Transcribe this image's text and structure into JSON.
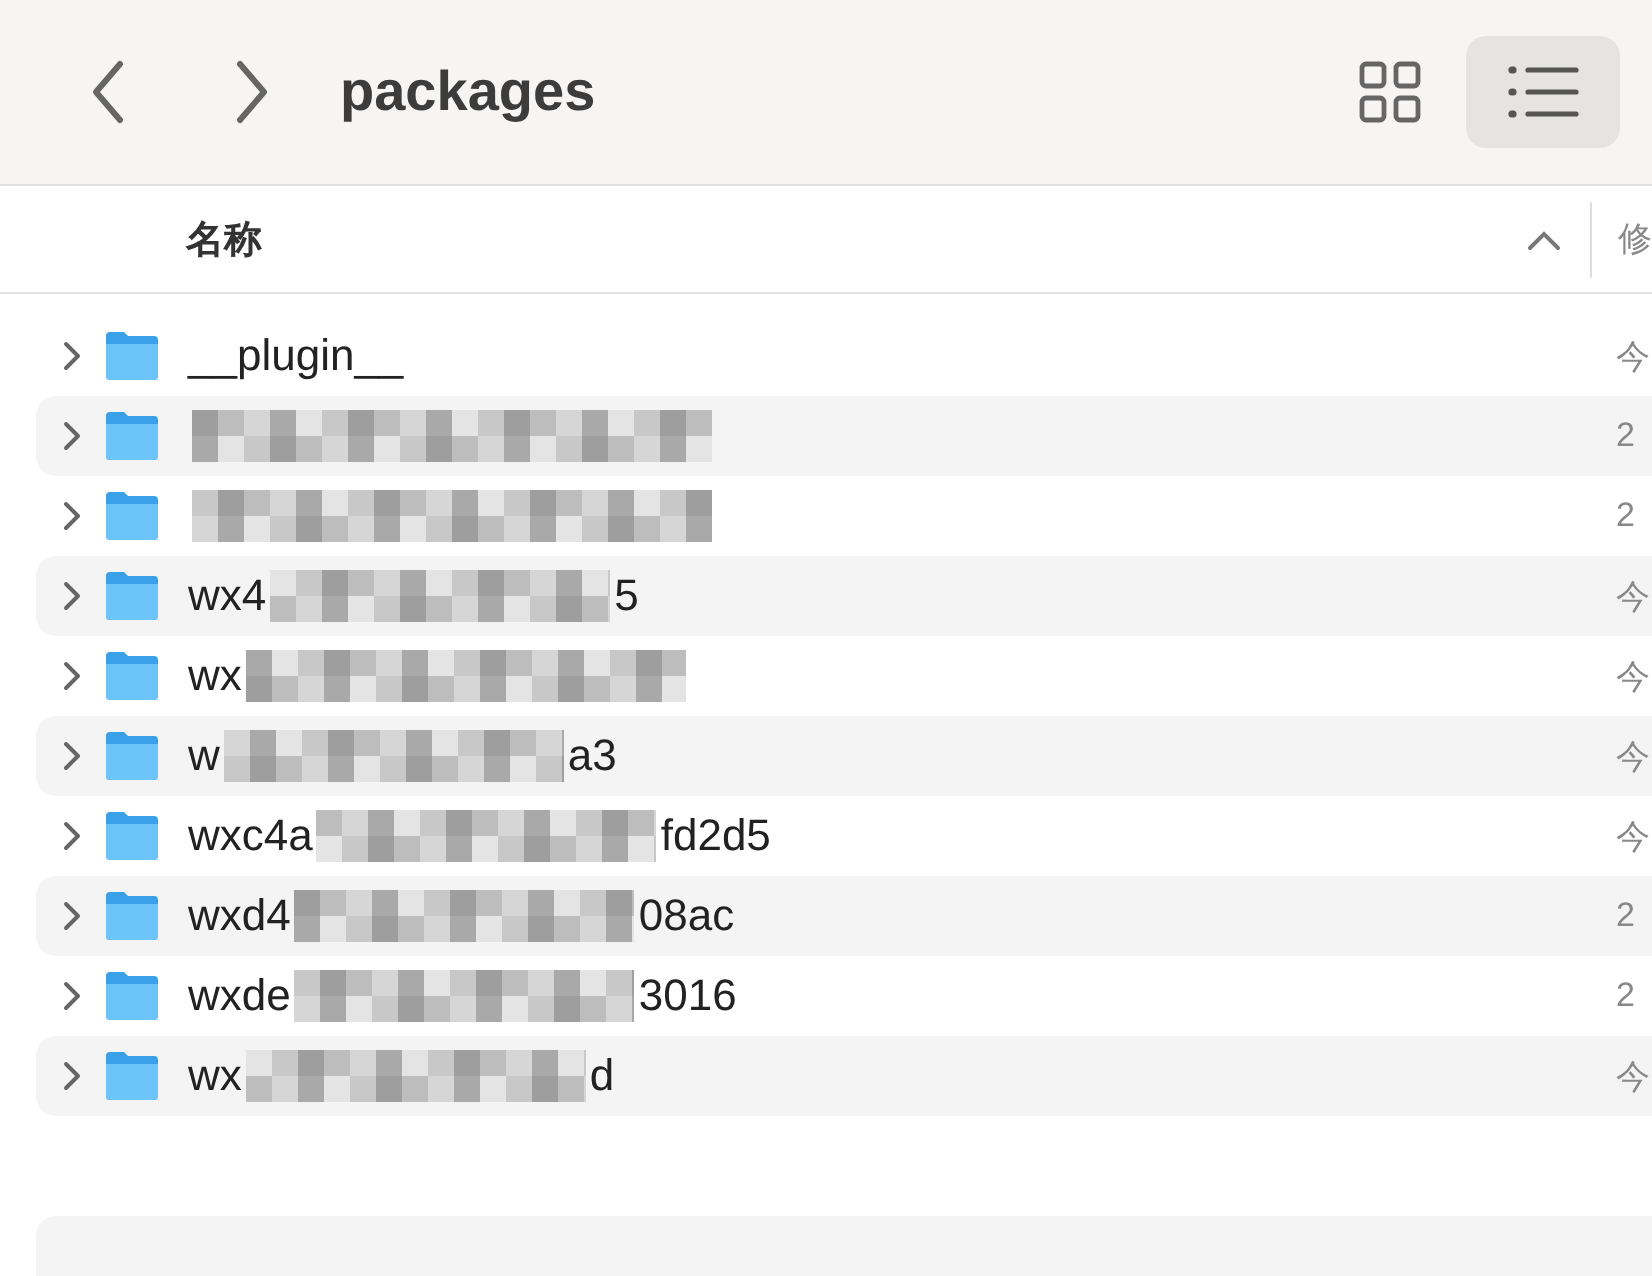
{
  "toolbar": {
    "title": "packages",
    "view_modes": [
      {
        "kind": "grid",
        "selected": false
      },
      {
        "kind": "list",
        "selected": true
      }
    ]
  },
  "columns": [
    {
      "label": "名称",
      "sorted": true
    },
    {
      "label": "修"
    }
  ],
  "rows": [
    {
      "name_start": "__plugin__",
      "redacted": false,
      "modified": "今"
    },
    {
      "redacted": true,
      "modified": "2"
    },
    {
      "redacted": true,
      "modified": "2"
    },
    {
      "name_start": "wx4",
      "name_end": "5",
      "redacted": true,
      "modified": "今"
    },
    {
      "name_start": "wx",
      "redacted": true,
      "modified": "今"
    },
    {
      "name_start": "w",
      "name_end": "a3",
      "redacted": true,
      "modified": "今"
    },
    {
      "name_start": "wxc4a",
      "name_end": "fd2d5",
      "redacted": true,
      "modified": "今"
    },
    {
      "name_start": "wxd4",
      "name_end": "08ac",
      "redacted": true,
      "modified": "2"
    },
    {
      "name_start": "wxde",
      "name_end": "3016",
      "redacted": true,
      "modified": "2"
    },
    {
      "name_start": "wx",
      "name_end": "d",
      "redacted": true,
      "modified": "今"
    }
  ]
}
